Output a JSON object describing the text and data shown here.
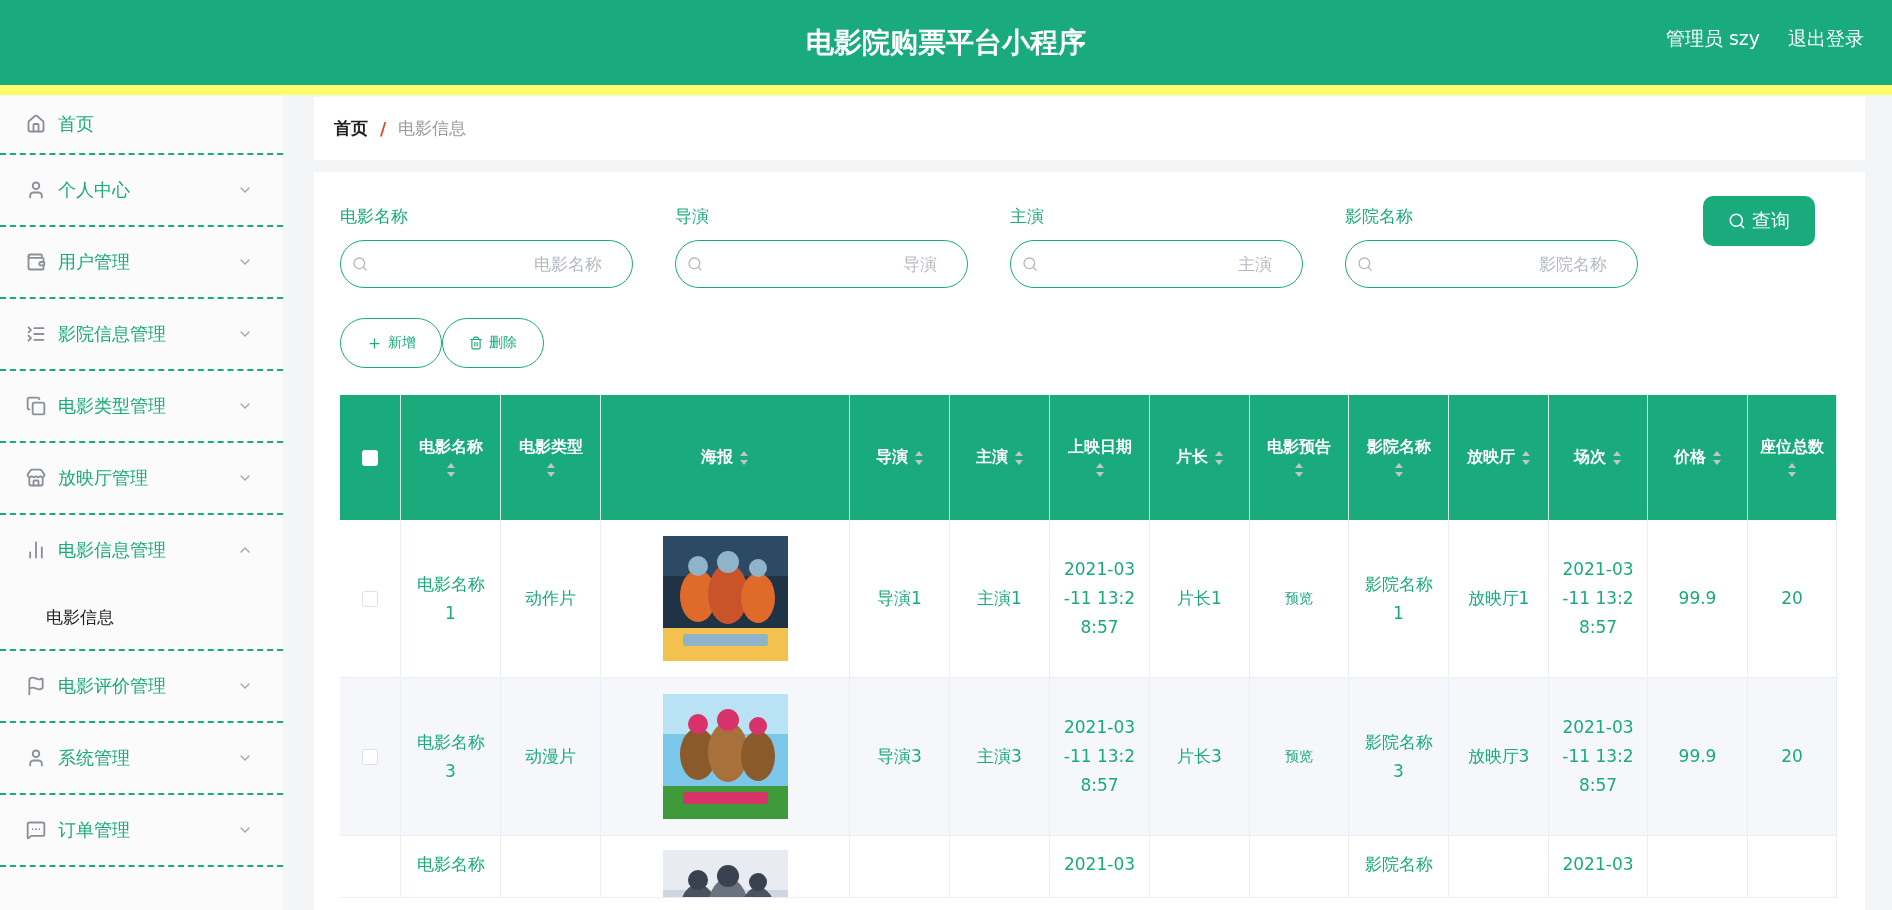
{
  "header": {
    "title": "电影院购票平台小程序",
    "user": "管理员 szy",
    "logout": "退出登录"
  },
  "sidebar": {
    "items": [
      {
        "kind": "link",
        "label": "首页"
      },
      {
        "kind": "menu",
        "label": "个人中心",
        "expanded": false
      },
      {
        "kind": "menu",
        "label": "用户管理",
        "expanded": false
      },
      {
        "kind": "menu",
        "label": "影院信息管理",
        "expanded": false
      },
      {
        "kind": "menu",
        "label": "电影类型管理",
        "expanded": false
      },
      {
        "kind": "menu",
        "label": "放映厅管理",
        "expanded": false
      },
      {
        "kind": "menu",
        "label": "电影信息管理",
        "expanded": true,
        "children": [
          {
            "label": "电影信息"
          }
        ]
      },
      {
        "kind": "menu",
        "label": "电影评价管理",
        "expanded": false
      },
      {
        "kind": "menu",
        "label": "系统管理",
        "expanded": false
      },
      {
        "kind": "menu",
        "label": "订单管理",
        "expanded": false
      }
    ]
  },
  "breadcrumb": {
    "items": [
      "首页",
      "电影信息"
    ],
    "separator": "/"
  },
  "search": {
    "fields": [
      {
        "label": "电影名称",
        "placeholder": "电影名称"
      },
      {
        "label": "导演",
        "placeholder": "导演"
      },
      {
        "label": "主演",
        "placeholder": "主演"
      },
      {
        "label": "影院名称",
        "placeholder": "影院名称"
      }
    ],
    "button": "查询"
  },
  "actions": [
    {
      "kind": "add",
      "label": "新增"
    },
    {
      "kind": "delete",
      "label": "删除"
    }
  ],
  "table": {
    "all_checked": false,
    "columns": [
      "电影名称",
      "电影类型",
      "海报",
      "导演",
      "主演",
      "上映日期",
      "片长",
      "电影预告",
      "影院名称",
      "放映厅",
      "场次",
      "价格",
      "座位总数"
    ],
    "rows": [
      {
        "checked": false,
        "cells": [
          "电影名称1",
          "动作片",
          "",
          "导演1",
          "主演1",
          "2021-03-11 13:28:57",
          "片长1",
          "预览",
          "影院名称1",
          "放映厅1",
          "2021-03-11 13:28:57",
          "99.9",
          "20"
        ]
      },
      {
        "checked": false,
        "cells": [
          "电影名称3",
          "动漫片",
          "",
          "导演3",
          "主演3",
          "2021-03-11 13:28:57",
          "片长3",
          "预览",
          "影院名称3",
          "放映厅3",
          "2021-03-11 13:28:57",
          "99.9",
          "20"
        ]
      },
      {
        "cells": [
          "电影名称",
          "",
          "",
          "",
          "",
          "2021-03",
          "",
          "",
          "影院名称",
          "",
          "2021-03",
          "",
          ""
        ]
      }
    ]
  }
}
